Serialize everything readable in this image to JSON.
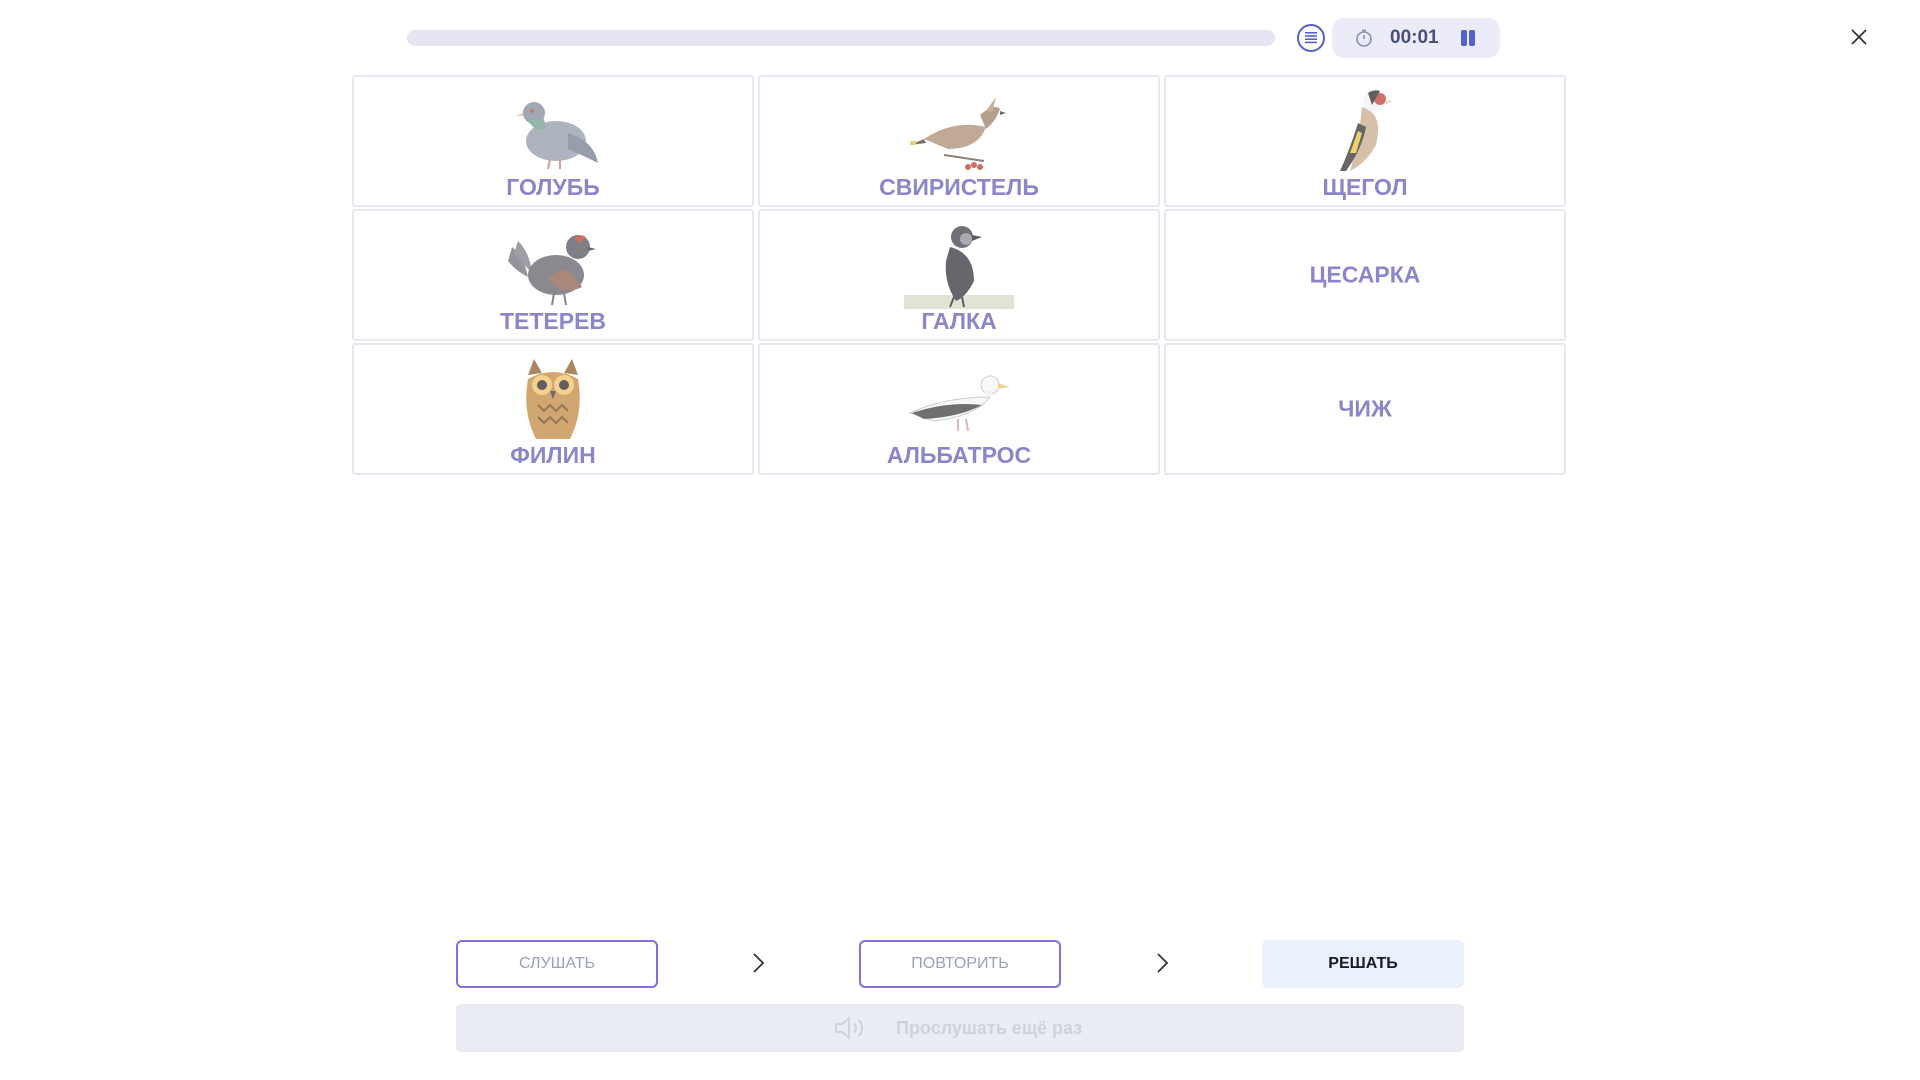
{
  "topbar": {
    "progress": 0.0,
    "timer": "00:01"
  },
  "cards": [
    {
      "label": "ГОЛУБЬ",
      "icon": "pigeon-image"
    },
    {
      "label": "СВИРИСТЕЛЬ",
      "icon": "waxwing-image"
    },
    {
      "label": "ЩЕГОЛ",
      "icon": "goldfinch-image"
    },
    {
      "label": "ТЕТЕРЕВ",
      "icon": "black-grouse-image"
    },
    {
      "label": "ГАЛКА",
      "icon": "jackdaw-image"
    },
    {
      "label": "ЦЕСАРКА"
    },
    {
      "label": "ФИЛИН",
      "icon": "eagle-owl-image"
    },
    {
      "label": "АЛЬБАТРОС",
      "icon": "albatross-image"
    },
    {
      "label": "ЧИЖ"
    }
  ],
  "controls": {
    "listen_label": "СЛУШАТЬ",
    "repeat_label": "ПОВТОРИТЬ",
    "solve_label": "РЕШАТЬ",
    "replay_label": "Прослушать ещё раз"
  },
  "colors": {
    "accent": "#5560c8",
    "card_label": "#8b86c8",
    "step_border": "#7c72d8",
    "solve_bg": "#eaf1fd",
    "replay_bg": "#e9ecf2"
  }
}
